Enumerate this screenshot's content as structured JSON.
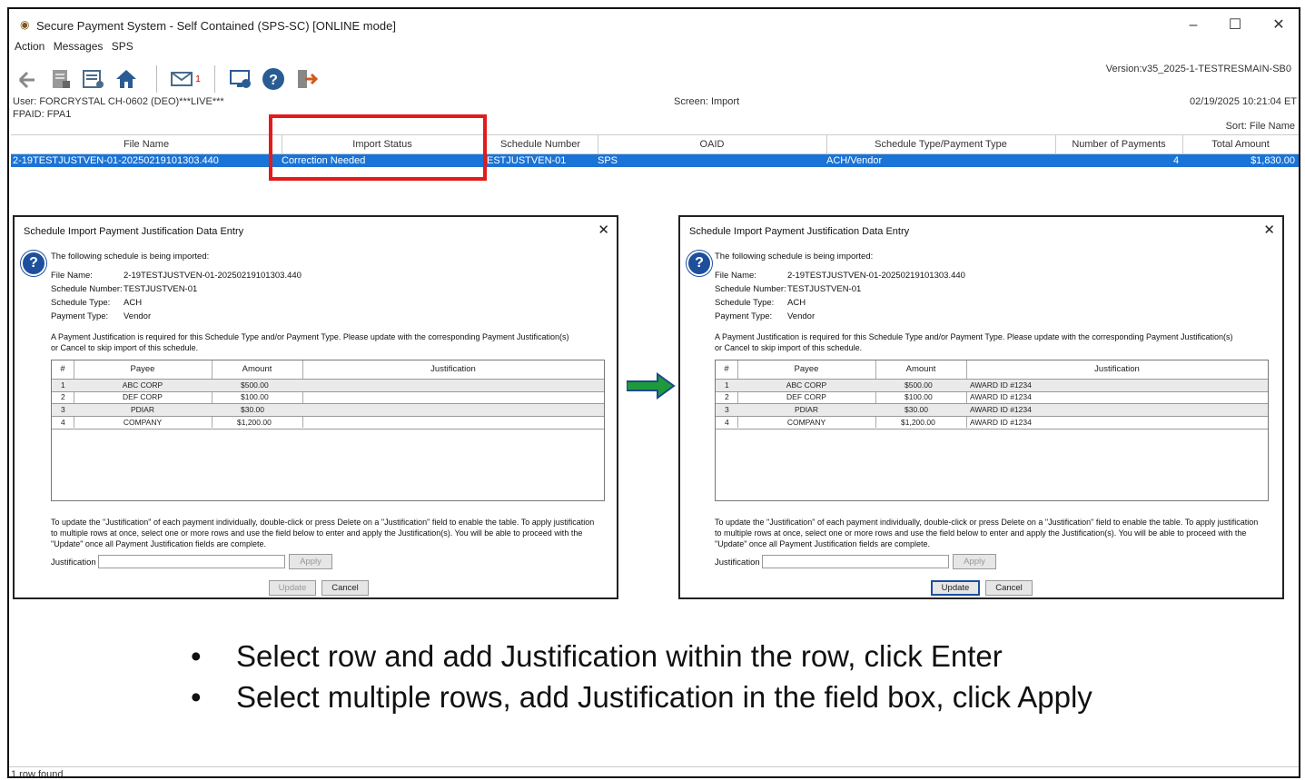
{
  "window": {
    "title": "Secure Payment System - Self Contained (SPS-SC) [ONLINE mode]",
    "menu": [
      "Action",
      "Messages",
      "SPS"
    ],
    "mail_count": "1",
    "version": "Version:v35_2025-1-TESTRESMAIN-SB0",
    "user": "User: FORCRYSTAL CH-0602 (DEO)***LIVE***",
    "fpaid": "FPAID: FPA1",
    "screen": "Screen: Import",
    "datetime": "02/19/2025 10:21:04 ET",
    "sort": "Sort:  File Name",
    "status": "1 row found."
  },
  "grid": {
    "columns": [
      "File Name",
      "Import Status",
      "Schedule Number",
      "OAID",
      "Schedule Type/Payment Type",
      "Number of Payments",
      "Total Amount"
    ],
    "row": {
      "file_name": "2-19TESTJUSTVEN-01-20250219101303.440",
      "import_status": "Correction Needed",
      "schedule_number": "ESTJUSTVEN-01",
      "oaid": "SPS",
      "type": "ACH/Vendor",
      "num_payments": "4",
      "total": "$1,830.00"
    }
  },
  "dialog": {
    "title": "Schedule Import Payment Justification Data Entry",
    "intro": "The following schedule is being imported:",
    "file_name_label": "File Name:",
    "file_name": "2-19TESTJUSTVEN-01-20250219101303.440",
    "schedule_number_label": "Schedule Number:",
    "schedule_number": "TESTJUSTVEN-01",
    "schedule_type_label": "Schedule Type:",
    "schedule_type": "ACH",
    "payment_type_label": "Payment Type:",
    "payment_type": "Vendor",
    "notice1": "A Payment Justification is required for this Schedule Type and/or Payment Type. Please update with the corresponding Payment Justification(s)",
    "notice2": "or Cancel to skip import of this schedule.",
    "table_headers": [
      "#",
      "Payee",
      "Amount",
      "Justification"
    ],
    "instr1": "To update the \"Justification\" of each payment individually, double-click or press Delete on a \"Justification\" field to enable the table. To apply justification",
    "instr2": "to multiple rows at once, select one or more rows and use the field below to enter and apply the Justification(s). You will be able to proceed with the",
    "instr3": "\"Update\" once all Payment Justification fields are complete.",
    "justification_label": "Justification",
    "apply": "Apply",
    "update": "Update",
    "cancel": "Cancel"
  },
  "left_rows": [
    {
      "n": "1",
      "payee": "ABC CORP",
      "amount": "$500.00",
      "just": ""
    },
    {
      "n": "2",
      "payee": "DEF CORP",
      "amount": "$100.00",
      "just": ""
    },
    {
      "n": "3",
      "payee": "PDIAR",
      "amount": "$30.00",
      "just": ""
    },
    {
      "n": "4",
      "payee": "COMPANY",
      "amount": "$1,200.00",
      "just": ""
    }
  ],
  "right_rows": [
    {
      "n": "1",
      "payee": "ABC CORP",
      "amount": "$500.00",
      "just": "AWARD ID #1234"
    },
    {
      "n": "2",
      "payee": "DEF CORP",
      "amount": "$100.00",
      "just": "AWARD ID #1234"
    },
    {
      "n": "3",
      "payee": "PDIAR",
      "amount": "$30.00",
      "just": "AWARD ID #1234"
    },
    {
      "n": "4",
      "payee": "COMPANY",
      "amount": "$1,200.00",
      "just": "AWARD ID #1234"
    }
  ],
  "bullets": [
    "Select row and add Justification within the row, click Enter",
    "Select multiple rows, add Justification in the field box, click Apply"
  ],
  "colors": {
    "selection": "#1a73d6",
    "highlight_box": "#e21b1b",
    "arrow": "#1e9a3c"
  }
}
